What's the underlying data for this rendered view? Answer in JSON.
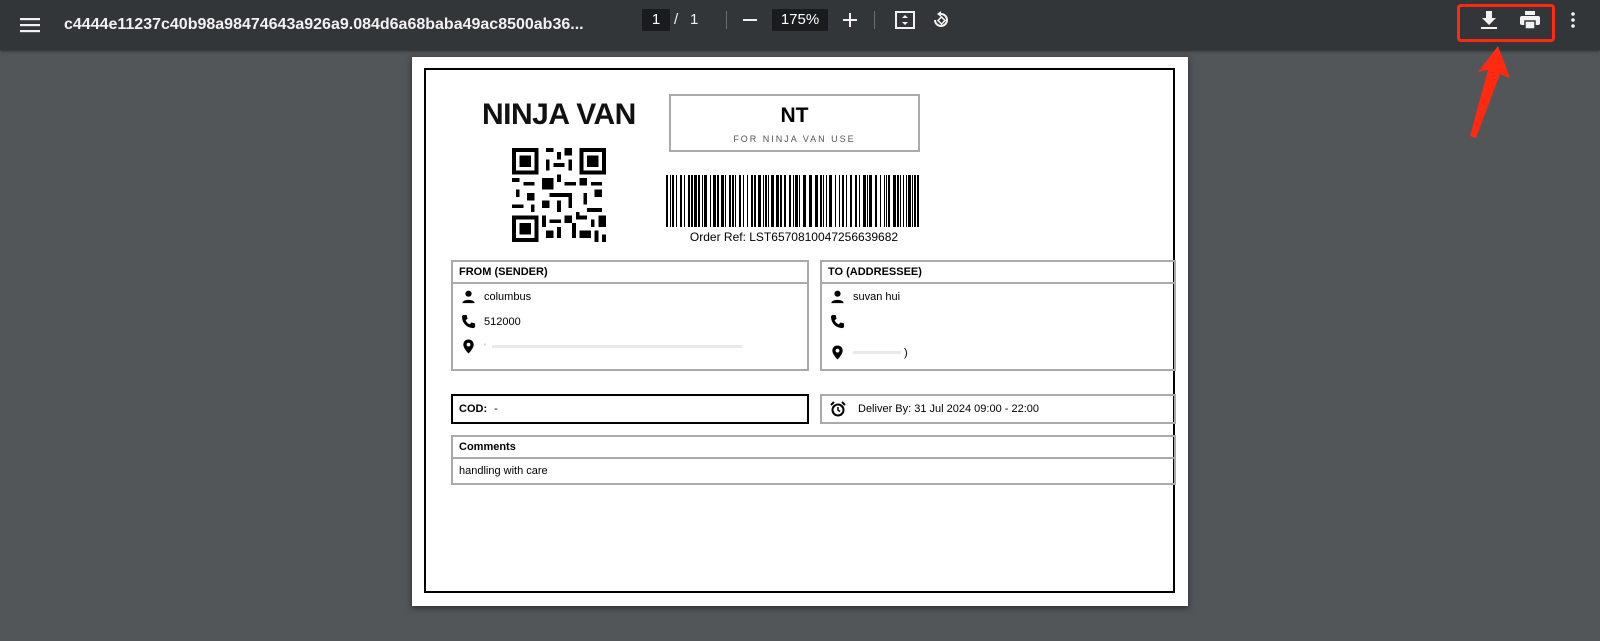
{
  "toolbar": {
    "title": "c4444e11237c40b98a98474643a926a9.084d6a68baba49ac8500ab36...",
    "current_page": "1",
    "page_separator": "/",
    "total_pages": "1",
    "zoom": "175%"
  },
  "label": {
    "brand": "NINJA VAN",
    "nt_code": "NT",
    "nt_caption": "FOR NINJA VAN USE",
    "order_ref": "Order Ref: LST6570810047256639682",
    "from": {
      "heading": "FROM (SENDER)",
      "name": "columbus",
      "phone": "512000",
      "address": "‘"
    },
    "to": {
      "heading": "TO (ADDRESSEE)",
      "name": "suvan hui",
      "phone": "",
      "address": ")"
    },
    "cod_label": "COD:",
    "cod_value": "-",
    "deliver_by": "Deliver By: 31 Jul 2024 09:00 - 22:00",
    "comments_heading": "Comments",
    "comments_text": "handling with care"
  },
  "colors": {
    "highlight": "#ff2a10",
    "toolbar_bg": "#323639",
    "viewer_bg": "#525659"
  },
  "icons": [
    "menu-icon",
    "minus-icon",
    "plus-icon",
    "fit-page-icon",
    "rotate-icon",
    "download-icon",
    "print-icon",
    "more-icon",
    "person-icon",
    "phone-icon",
    "location-icon",
    "alarm-clock-icon",
    "red-arrow-icon"
  ]
}
